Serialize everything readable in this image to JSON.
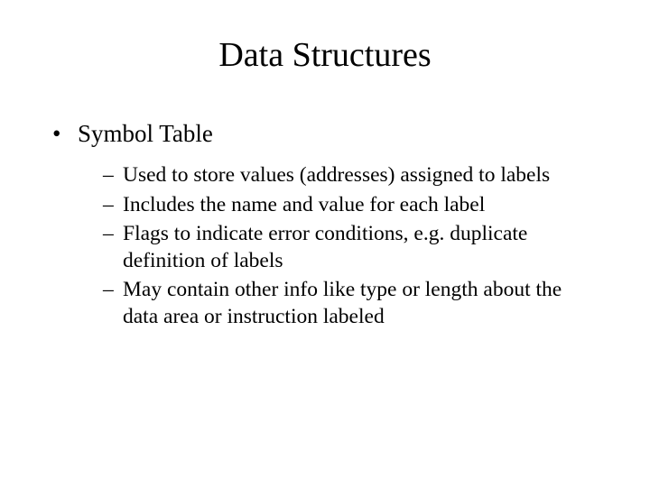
{
  "title": "Data Structures",
  "bullets": [
    {
      "text": "Symbol Table",
      "sub": [
        "Used to store values (addresses) assigned to labels",
        "Includes the name and value for each label",
        "Flags to indicate error conditions, e.g. duplicate definition of labels",
        "May contain other info like type or length about the data area or instruction labeled"
      ]
    }
  ]
}
